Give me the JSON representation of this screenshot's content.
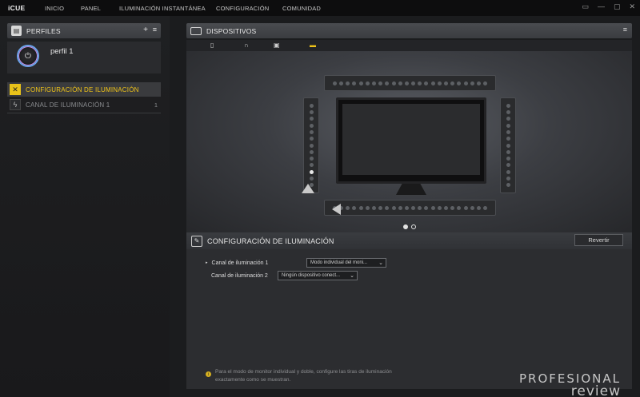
{
  "app": {
    "logo": "iCUE",
    "nav": [
      "INICIO",
      "PANEL",
      "ILUMINACIÓN INSTANTÁNEA",
      "CONFIGURACIÓN",
      "COMUNIDAD"
    ],
    "window_controls": [
      "▭",
      "—",
      "▢",
      "✕"
    ]
  },
  "sidebar": {
    "profiles_title": "PERFILES",
    "profile_actions": [
      "+",
      "≡"
    ],
    "profile_name": "perfil 1",
    "lighting_config_label": "CONFIGURACIÓN DE ILUMINACIÓN",
    "channel_label": "CANAL DE ILUMINACIÓN 1",
    "channel_count": "1"
  },
  "devices": {
    "title": "DISPOSITIVOS",
    "menu_icon": "≡",
    "icons": [
      "mouse-icon",
      "headset-icon",
      "controller-icon",
      "monitor-strip-icon"
    ],
    "accent": "#f0c419"
  },
  "config": {
    "title": "CONFIGURACIÓN DE ILUMINACIÓN",
    "revert_label": "Revertir",
    "channel1_label": "Canal de iluminación 1",
    "channel1_value": "Modo individual del moni...",
    "channel2_label": "Canal de iluminación 2",
    "channel2_value": "Ningún dispositivo conect...",
    "info_text": "Para el modo de monitor individual y doble, configure las tiras de iluminación exactamente como se muestran."
  },
  "watermark": {
    "line1": "PROFESIONAL",
    "line2": "review"
  }
}
